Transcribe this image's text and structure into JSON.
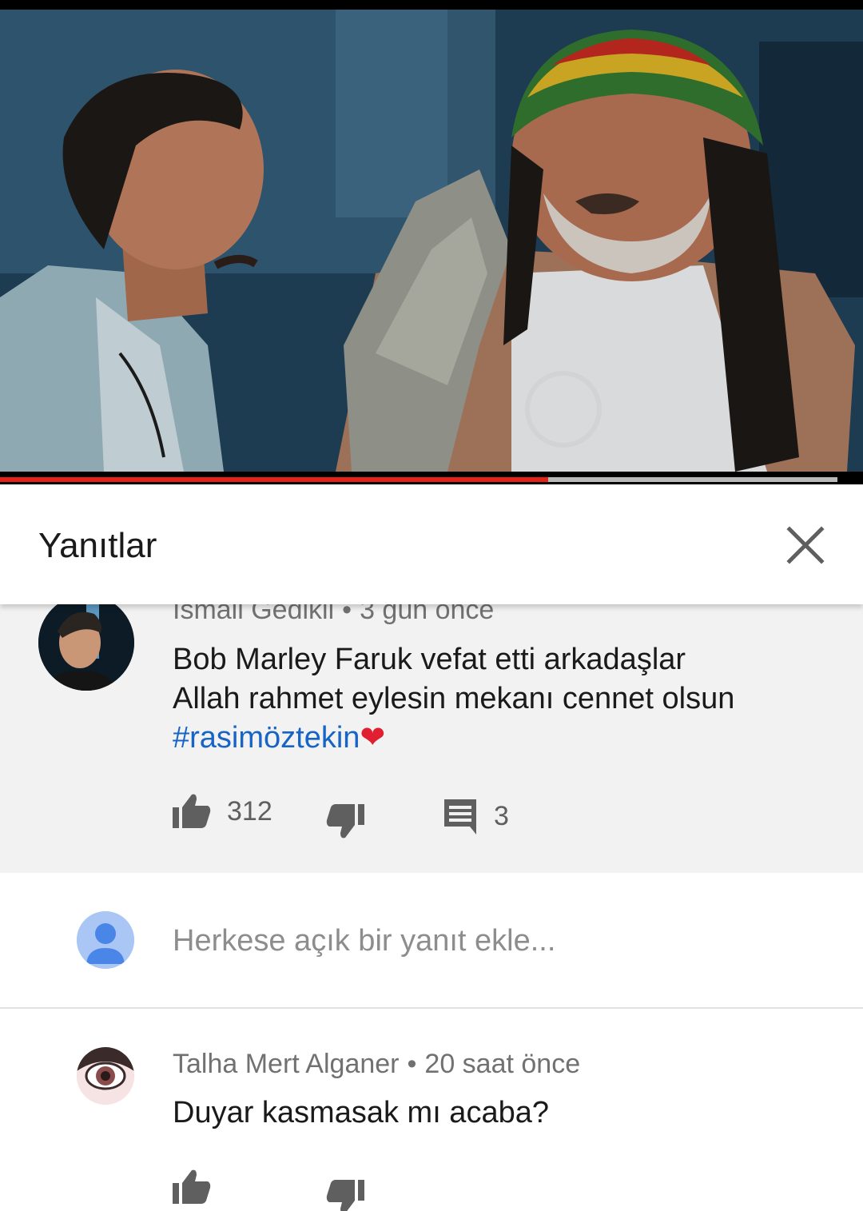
{
  "video": {
    "progress_fraction": 0.655,
    "colors": {
      "played": "#e62117",
      "unplayed": "#b9b9b9"
    }
  },
  "panel": {
    "title": "Yanıtlar",
    "close_icon": "close-icon"
  },
  "parent_comment": {
    "author": "İsmail Gedikli",
    "time": "3 gün önce",
    "text_line1": "Bob Marley Faruk vefat etti arkadaşlar",
    "text_line2": "Allah rahmet eylesin mekanı cennet olsun",
    "hashtag": "#rasimöztekin",
    "emoji": "❤",
    "likes": "312",
    "replies": "3",
    "like_icon": "thumbs-up-icon",
    "dislike_icon": "thumbs-down-icon",
    "reply_icon": "comment-icon"
  },
  "reply_box": {
    "placeholder": "Herkese açık bir yanıt ekle...",
    "avatar_icon": "user-icon"
  },
  "replies": [
    {
      "author": "Talha Mert Alganer",
      "time": "20 saat önce",
      "text": "Duyar kasmasak mı acaba?"
    }
  ],
  "separator": "•"
}
